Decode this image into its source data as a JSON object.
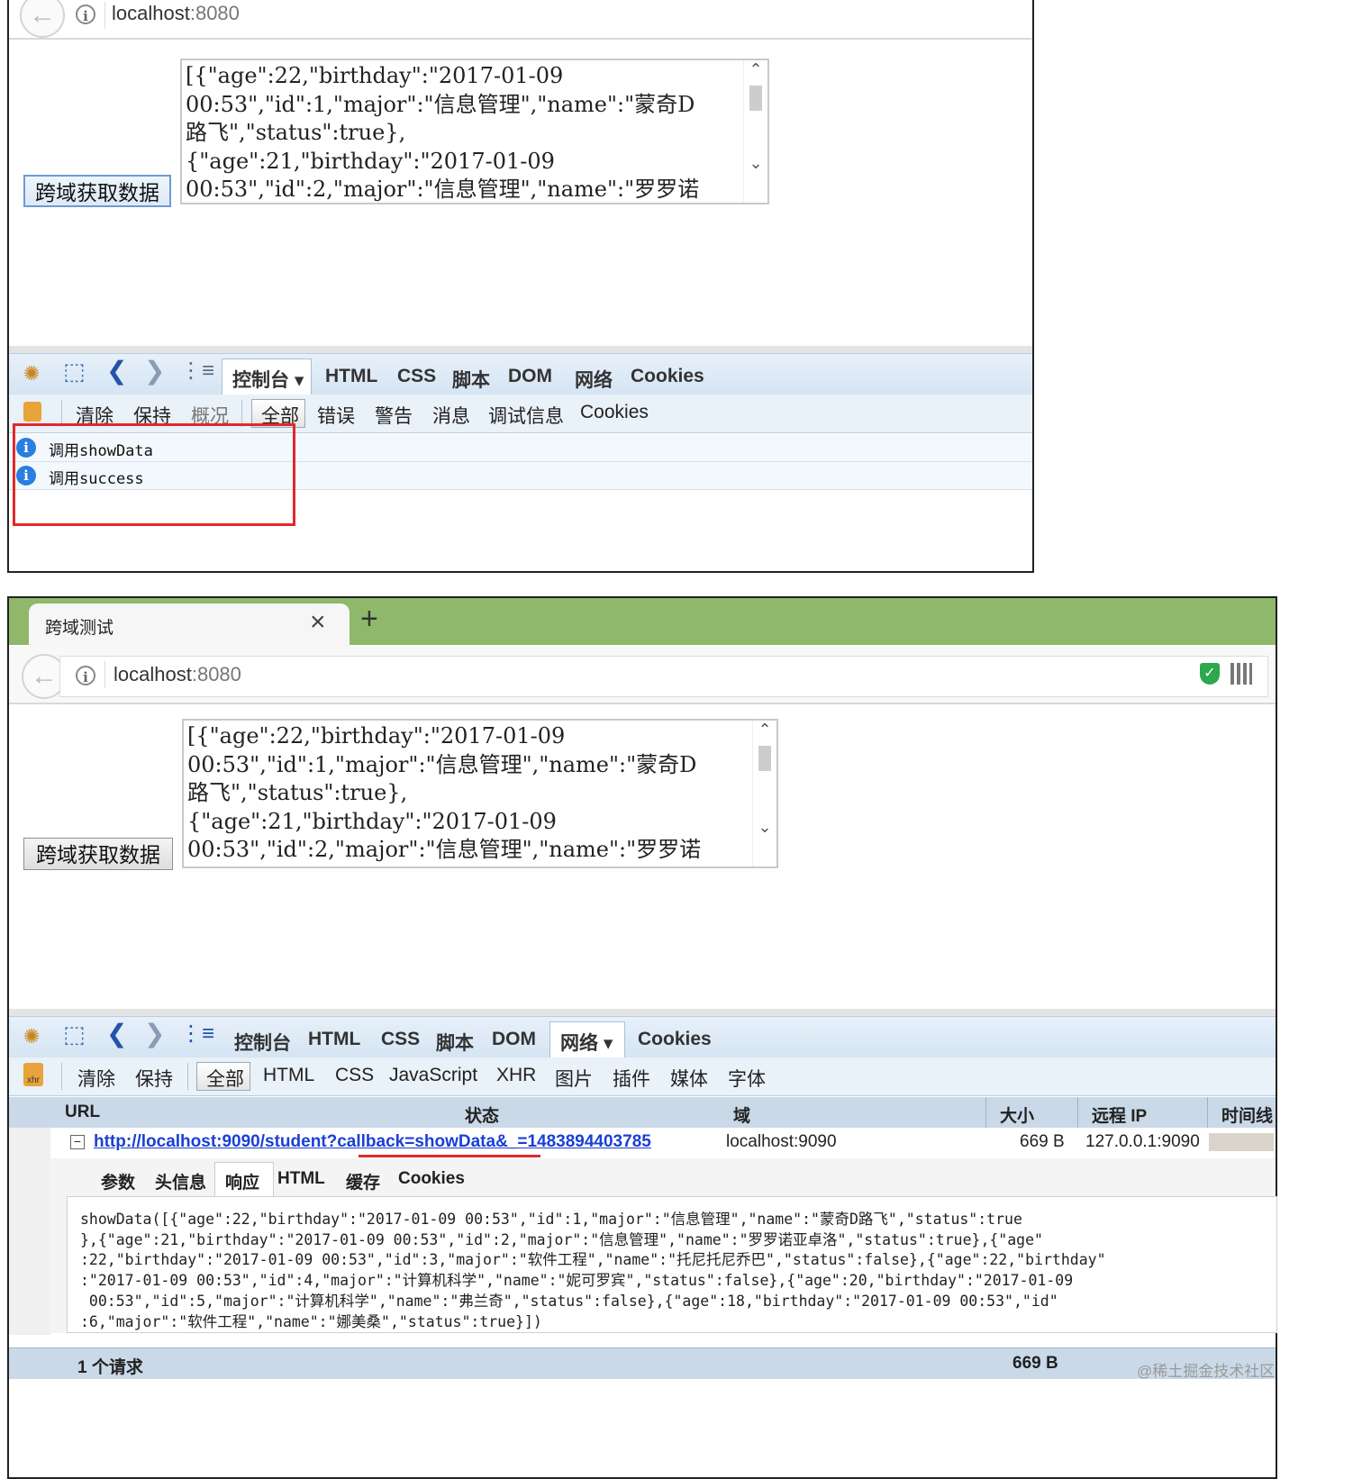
{
  "top": {
    "url_host": "localhost",
    "url_port": ":8080",
    "button_label": "跨域获取数据",
    "textarea_lines": [
      "[{\"age\":22,\"birthday\":\"2017-01-09",
      "00:53\",\"id\":1,\"major\":\"信息管理\",\"name\":\"蒙奇D",
      "路飞\",\"status\":true},",
      "{\"age\":21,\"birthday\":\"2017-01-09",
      "00:53\",\"id\":2,\"major\":\"信息管理\",\"name\":\"罗罗诺"
    ],
    "firebug_tabs": [
      "控制台",
      "HTML",
      "CSS",
      "脚本",
      "DOM",
      "网络",
      "Cookies"
    ],
    "console_toolbar": [
      "清除",
      "保持",
      "概况",
      "全部",
      "错误",
      "警告",
      "消息",
      "调试信息",
      "Cookies"
    ],
    "console_rows": [
      "调用showData",
      "调用success"
    ],
    "highlight_color": "#e0292b"
  },
  "bottom": {
    "tab_title": "跨域测试",
    "tab_close": "×",
    "new_tab": "+",
    "url_host": "localhost",
    "url_port": ":8080",
    "button_label": "跨域获取数据",
    "textarea_lines": [
      "[{\"age\":22,\"birthday\":\"2017-01-09",
      "00:53\",\"id\":1,\"major\":\"信息管理\",\"name\":\"蒙奇D",
      "路飞\",\"status\":true},",
      "{\"age\":21,\"birthday\":\"2017-01-09",
      "00:53\",\"id\":2,\"major\":\"信息管理\",\"name\":\"罗罗诺"
    ],
    "firebug_tabs": [
      "控制台",
      "HTML",
      "CSS",
      "脚本",
      "DOM",
      "网络",
      "Cookies"
    ],
    "net_toolbar": [
      "清除",
      "保持",
      "全部",
      "HTML",
      "CSS",
      "JavaScript",
      "XHR",
      "图片",
      "插件",
      "媒体",
      "字体"
    ],
    "columns": [
      "URL",
      "状态",
      "域",
      "大小",
      "远程 IP",
      "时间线"
    ],
    "request": {
      "url": "http://localhost:9090/student?callback=showData&_=1483894403785",
      "domain": "localhost:9090",
      "size": "669 B",
      "remote_ip": "127.0.0.1:9090"
    },
    "detail_tabs": [
      "参数",
      "头信息",
      "响应",
      "HTML",
      "缓存",
      "Cookies"
    ],
    "response_lines": [
      "showData([{\"age\":22,\"birthday\":\"2017-01-09 00:53\",\"id\":1,\"major\":\"信息管理\",\"name\":\"蒙奇D路飞\",\"status\":true",
      "},{\"age\":21,\"birthday\":\"2017-01-09 00:53\",\"id\":2,\"major\":\"信息管理\",\"name\":\"罗罗诺亚卓洛\",\"status\":true},{\"age\"",
      ":22,\"birthday\":\"2017-01-09 00:53\",\"id\":3,\"major\":\"软件工程\",\"name\":\"托尼托尼乔巴\",\"status\":false},{\"age\":22,\"birthday\"",
      ":\"2017-01-09 00:53\",\"id\":4,\"major\":\"计算机科学\",\"name\":\"妮可罗宾\",\"status\":false},{\"age\":20,\"birthday\":\"2017-01-09",
      " 00:53\",\"id\":5,\"major\":\"计算机科学\",\"name\":\"弗兰奇\",\"status\":false},{\"age\":18,\"birthday\":\"2017-01-09 00:53\",\"id\"",
      ":6,\"major\":\"软件工程\",\"name\":\"娜美桑\",\"status\":true}])"
    ],
    "summary_count": "1 个请求",
    "summary_size": "669 B",
    "underline_color": "#e0292b",
    "tabbar_color": "#8fb86a"
  },
  "watermark": "@稀土掘金技术社区"
}
